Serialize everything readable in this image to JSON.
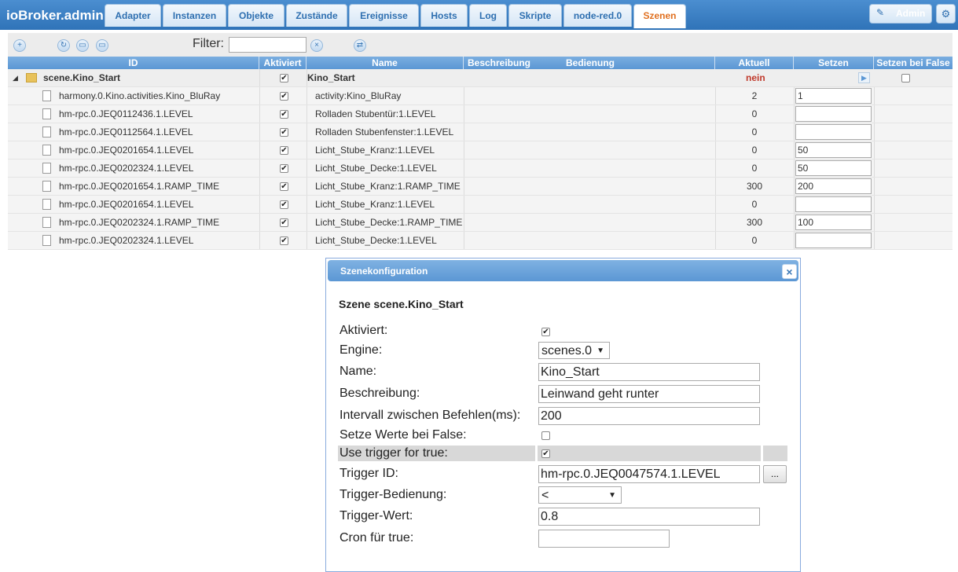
{
  "app_title": "ioBroker.admin",
  "tabs": [
    {
      "label": "Adapter",
      "active": false
    },
    {
      "label": "Instanzen",
      "active": false
    },
    {
      "label": "Objekte",
      "active": false
    },
    {
      "label": "Zustände",
      "active": false
    },
    {
      "label": "Ereignisse",
      "active": false
    },
    {
      "label": "Hosts",
      "active": false
    },
    {
      "label": "Log",
      "active": false
    },
    {
      "label": "Skripte",
      "active": false
    },
    {
      "label": "node-red.0",
      "active": false
    },
    {
      "label": "Szenen",
      "active": true
    }
  ],
  "user": {
    "label": "Admin"
  },
  "toolbar": {
    "filter_label": "Filter:",
    "filter_value": ""
  },
  "table": {
    "columns": [
      "ID",
      "Aktiviert",
      "Name",
      "Beschreibung",
      "Bedienung",
      "Aktuell",
      "Setzen",
      "Setzen bei False"
    ],
    "scene": {
      "id": "scene.Kino_Start",
      "enabled": true,
      "name": "Kino_Start",
      "aktuell": "nein",
      "false_checked": false
    },
    "rows": [
      {
        "id": "harmony.0.Kino.activities.Kino_BluRay",
        "enabled": true,
        "name": "activity:Kino_BluRay",
        "aktuell": "2",
        "setzen": "1"
      },
      {
        "id": "hm-rpc.0.JEQ0112436.1.LEVEL",
        "enabled": true,
        "name": "Rolladen Stubentür:1.LEVEL",
        "aktuell": "0",
        "setzen": ""
      },
      {
        "id": "hm-rpc.0.JEQ0112564.1.LEVEL",
        "enabled": true,
        "name": "Rolladen Stubenfenster:1.LEVEL",
        "aktuell": "0",
        "setzen": ""
      },
      {
        "id": "hm-rpc.0.JEQ0201654.1.LEVEL",
        "enabled": true,
        "name": "Licht_Stube_Kranz:1.LEVEL",
        "aktuell": "0",
        "setzen": "50"
      },
      {
        "id": "hm-rpc.0.JEQ0202324.1.LEVEL",
        "enabled": true,
        "name": "Licht_Stube_Decke:1.LEVEL",
        "aktuell": "0",
        "setzen": "50"
      },
      {
        "id": "hm-rpc.0.JEQ0201654.1.RAMP_TIME",
        "enabled": true,
        "name": "Licht_Stube_Kranz:1.RAMP_TIME",
        "aktuell": "300",
        "setzen": "200"
      },
      {
        "id": "hm-rpc.0.JEQ0201654.1.LEVEL",
        "enabled": true,
        "name": "Licht_Stube_Kranz:1.LEVEL",
        "aktuell": "0",
        "setzen": ""
      },
      {
        "id": "hm-rpc.0.JEQ0202324.1.RAMP_TIME",
        "enabled": true,
        "name": "Licht_Stube_Decke:1.RAMP_TIME",
        "aktuell": "300",
        "setzen": "100"
      },
      {
        "id": "hm-rpc.0.JEQ0202324.1.LEVEL",
        "enabled": true,
        "name": "Licht_Stube_Decke:1.LEVEL",
        "aktuell": "0",
        "setzen": ""
      }
    ]
  },
  "dialog": {
    "title": "Szenekonfiguration",
    "heading": "Szene scene.Kino_Start",
    "fields": {
      "aktiviert": {
        "label": "Aktiviert:",
        "checked": true
      },
      "engine": {
        "label": "Engine:",
        "value": "scenes.0"
      },
      "name": {
        "label": "Name:",
        "value": "Kino_Start"
      },
      "beschreibung": {
        "label": "Beschreibung:",
        "value": "Leinwand geht runter"
      },
      "intervall": {
        "label": "Intervall zwischen Befehlen(ms):",
        "value": "200"
      },
      "setze_false": {
        "label": "Setze Werte bei False:",
        "checked": false
      },
      "use_trigger": {
        "label": "Use trigger for true:",
        "checked": true
      },
      "trigger_id": {
        "label": "Trigger ID:",
        "value": "hm-rpc.0.JEQ0047574.1.LEVEL",
        "button": "..."
      },
      "trigger_bedienung": {
        "label": "Trigger-Bedienung:",
        "value": "<"
      },
      "trigger_wert": {
        "label": "Trigger-Wert:",
        "value": "0.8"
      },
      "cron": {
        "label": "Cron für true:",
        "value": ""
      }
    }
  },
  "colors": {
    "accent": "#2f73b8",
    "active_tab": "#e07020",
    "scene_status": "#c0392b"
  }
}
